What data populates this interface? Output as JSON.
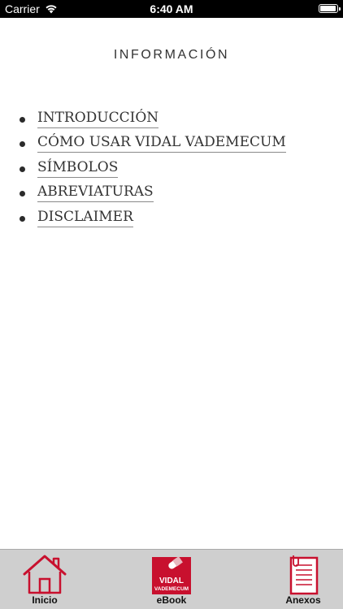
{
  "status_bar": {
    "carrier": "Carrier",
    "time": "6:40 AM"
  },
  "page": {
    "title": "INFORMACIÓN"
  },
  "links": [
    {
      "label": "INTRODUCCIÓN"
    },
    {
      "label": "CÓMO USAR VIDAL VADEMECUM"
    },
    {
      "label": "SÍMBOLOS"
    },
    {
      "label": "ABREVIATURAS"
    },
    {
      "label": "DISCLAIMER"
    }
  ],
  "tab_bar": {
    "tabs": [
      {
        "label": "Inicio",
        "icon": "home-icon"
      },
      {
        "label": "eBook",
        "icon": "vidal-vademecum-logo",
        "logo_line1": "VIDAL",
        "logo_line2": "VADEMECUM"
      },
      {
        "label": "Anexos",
        "icon": "notebook-icon"
      }
    ]
  },
  "colors": {
    "brand_red": "#c8102e",
    "tab_bar_bg": "#cfcfcf"
  }
}
